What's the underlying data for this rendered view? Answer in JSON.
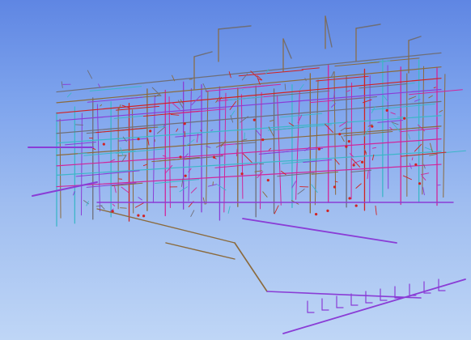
{
  "viewport": {
    "kind": "3d-model-view",
    "background_top": "#5f86e3",
    "background_bottom": "#bfd6f6"
  },
  "model": {
    "description_visible_text": "",
    "system_colors": {
      "pipe_purple": "#8a3dd6",
      "pipe_magenta": "#d0269b",
      "pipe_brown": "#8b6a3c",
      "pipe_red": "#d22222",
      "pipe_gray": "#6e6e78",
      "pipe_cyan": "#3cb6c8"
    }
  }
}
